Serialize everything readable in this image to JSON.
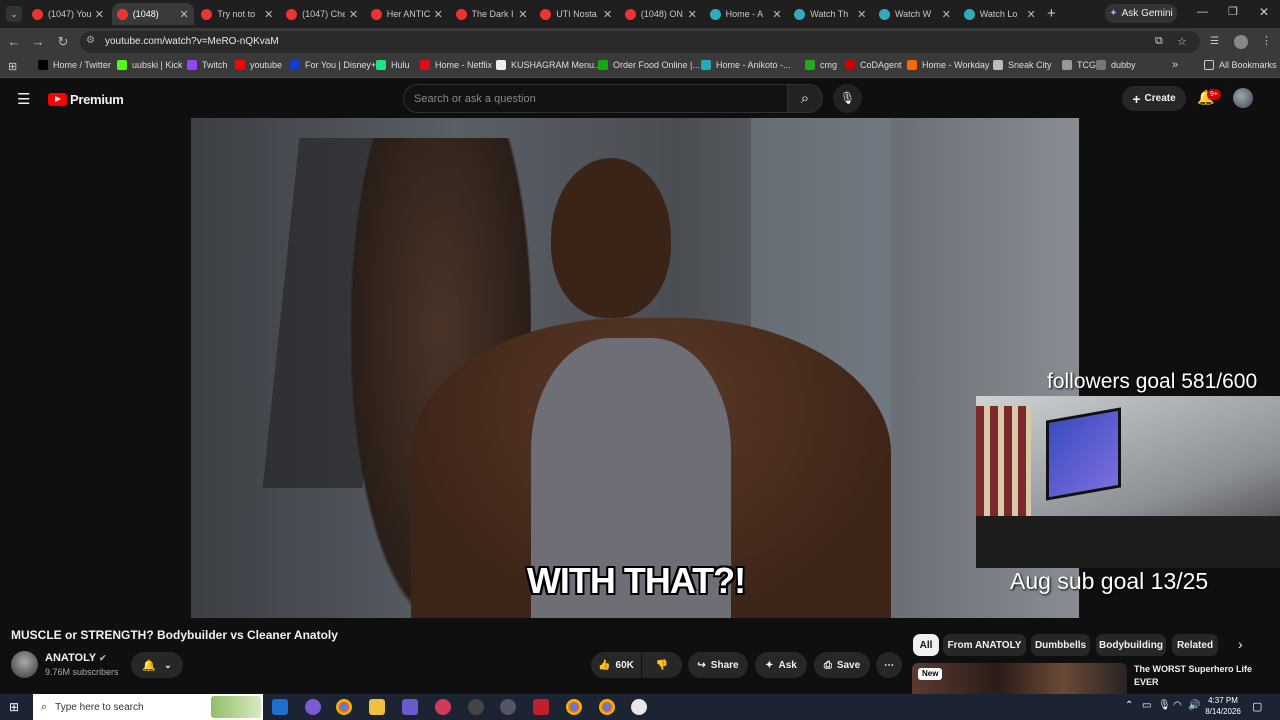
{
  "tabs": [
    {
      "title": "(1047) You",
      "active": false
    },
    {
      "title": "(1048)",
      "active": true
    },
    {
      "title": "Try not to",
      "active": false
    },
    {
      "title": "(1047) Che",
      "active": false
    },
    {
      "title": "Her ANTIC",
      "active": false
    },
    {
      "title": "The Dark I",
      "active": false
    },
    {
      "title": "UTI Nosta",
      "active": false
    },
    {
      "title": "(1048) ON",
      "active": false
    },
    {
      "title": "Home - A",
      "active": false
    },
    {
      "title": "Watch Th",
      "active": false
    },
    {
      "title": "Watch W",
      "active": false
    },
    {
      "title": "Watch Lo",
      "active": false
    }
  ],
  "gemini_label": "Ask Gemini",
  "url": "youtube.com/watch?v=MeRO-nQKvaM",
  "bookmarks": [
    "Home / Twitter",
    "uubski | Kick",
    "Twitch",
    "youtube",
    "For You | Disney+",
    "Hulu",
    "Home - Netflix",
    "KUSHAGRAM Menu...",
    "Order Food Online |...",
    "Home - Anikoto -...",
    "cmg",
    "CoDAgent",
    "Home - Workday",
    "Sneak City",
    "TCG",
    "dubby"
  ],
  "all_bookmarks": "All Bookmarks",
  "youtube": {
    "logo_text": "Premium",
    "search_placeholder": "Search or ask a question",
    "create_label": "Create",
    "notif_count": "9+"
  },
  "video": {
    "caption": "WITH THAT?!",
    "overlay_followers": "followers goal 581/600",
    "overlay_sub": "Aug sub goal 13/25"
  },
  "meta": {
    "title": "MUSCLE or STRENGTH? Bodybuilder vs Cleaner Anatoly",
    "channel": "ANATOLY",
    "subscribers": "9.76M subscribers",
    "likes": "60K",
    "share": "Share",
    "ask": "Ask",
    "save": "Save"
  },
  "chips": [
    "All",
    "From ANATOLY",
    "Dumbbells",
    "Bodybuilding",
    "Related"
  ],
  "rec": {
    "badge": "New",
    "title": "The WORST Superhero Life EVER"
  },
  "taskbar": {
    "search": "Type here to search",
    "time": "4:37 PM",
    "date": "8/14/2026"
  },
  "colors": {
    "youtube_red": "#ff0000",
    "tab_active": "#3a3a3a",
    "chip_active": "#f1f1f1"
  }
}
